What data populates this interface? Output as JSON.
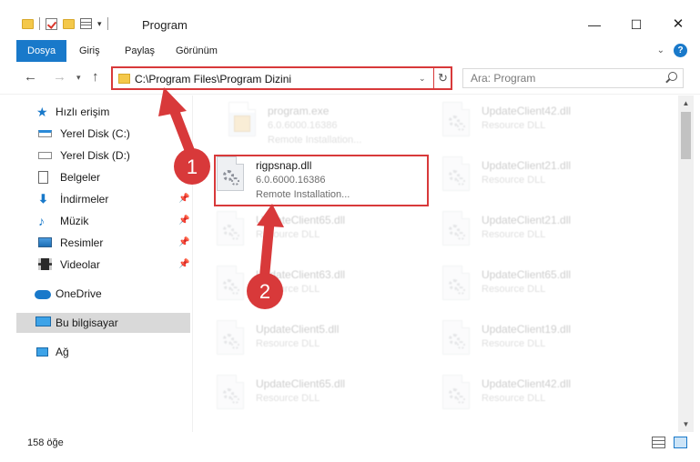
{
  "window": {
    "title": "Program",
    "minimize": "—",
    "maximize": "☐",
    "close": "✕"
  },
  "ribbon": {
    "tabs": [
      "Dosya",
      "Giriş",
      "Paylaş",
      "Görünüm"
    ],
    "expand_icon": "⌄",
    "help_label": "?"
  },
  "address": {
    "path": "C:\\Program Files\\Program Dizini",
    "search_placeholder": "Ara: Program"
  },
  "sidebar": {
    "items": [
      {
        "label": "Hızlı erişim"
      },
      {
        "label": "Yerel Disk (C:)"
      },
      {
        "label": "Yerel Disk (D:)"
      },
      {
        "label": "Belgeler"
      },
      {
        "label": "İndirmeler"
      },
      {
        "label": "Müzik"
      },
      {
        "label": "Resimler"
      },
      {
        "label": "Videolar"
      },
      {
        "label": "OneDrive"
      },
      {
        "label": "Bu bilgisayar"
      },
      {
        "label": "Ağ"
      }
    ]
  },
  "files": {
    "left": [
      {
        "name": "program.exe",
        "line1": "6.0.6000.16386",
        "line2": "Remote Installation..."
      },
      {
        "name": "rigpsnap.dll",
        "line1": "6.0.6000.16386",
        "line2": "Remote Installation..."
      },
      {
        "name": "UpdateClient65.dll",
        "line1": "Resource DLL",
        "line2": ""
      },
      {
        "name": "UpdateClient63.dll",
        "line1": "Resource DLL",
        "line2": ""
      },
      {
        "name": "UpdateClient5.dll",
        "line1": "Resource DLL",
        "line2": ""
      },
      {
        "name": "UpdateClient65.dll",
        "line1": "Resource DLL",
        "line2": ""
      }
    ],
    "right": [
      {
        "name": "UpdateClient42.dll",
        "line1": "Resource DLL"
      },
      {
        "name": "UpdateClient21.dll",
        "line1": "Resource DLL"
      },
      {
        "name": "UpdateClient21.dll",
        "line1": "Resource DLL"
      },
      {
        "name": "UpdateClient65.dll",
        "line1": "Resource DLL"
      },
      {
        "name": "UpdateClient19.dll",
        "line1": "Resource DLL"
      },
      {
        "name": "UpdateClient42.dll",
        "line1": "Resource DLL"
      }
    ]
  },
  "status": {
    "count": "158 öğe"
  },
  "annotations": {
    "step1": "1",
    "step2": "2",
    "color": "#d8393a"
  }
}
